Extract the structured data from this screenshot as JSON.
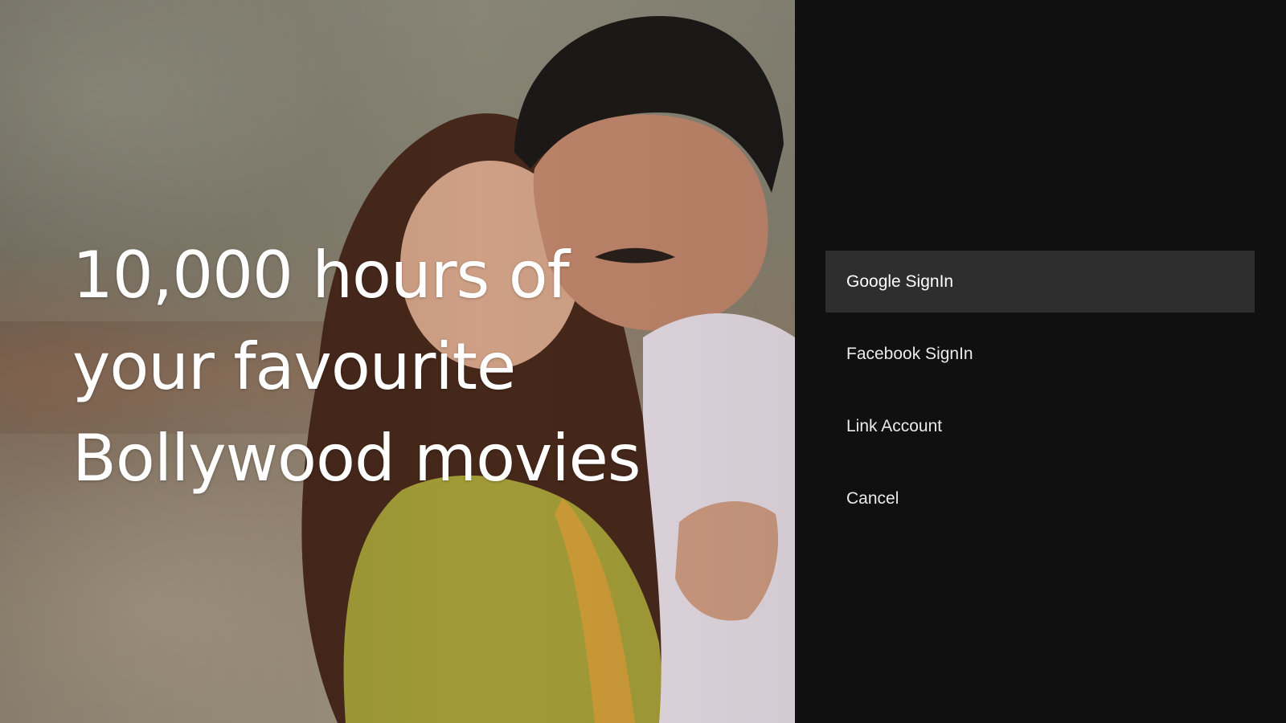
{
  "hero": {
    "tagline_lines": [
      "10,000 hours of",
      "your favourite",
      "Bollywood movies"
    ]
  },
  "signin_menu": {
    "items": [
      {
        "label": "Google SignIn",
        "focused": true
      },
      {
        "label": "Facebook SignIn",
        "focused": false
      },
      {
        "label": "Link Account",
        "focused": false
      },
      {
        "label": "Cancel",
        "focused": false
      }
    ]
  },
  "colors": {
    "panel_background": "#101010",
    "focused_item_background": "#2e2e2e",
    "text": "#ffffff"
  }
}
